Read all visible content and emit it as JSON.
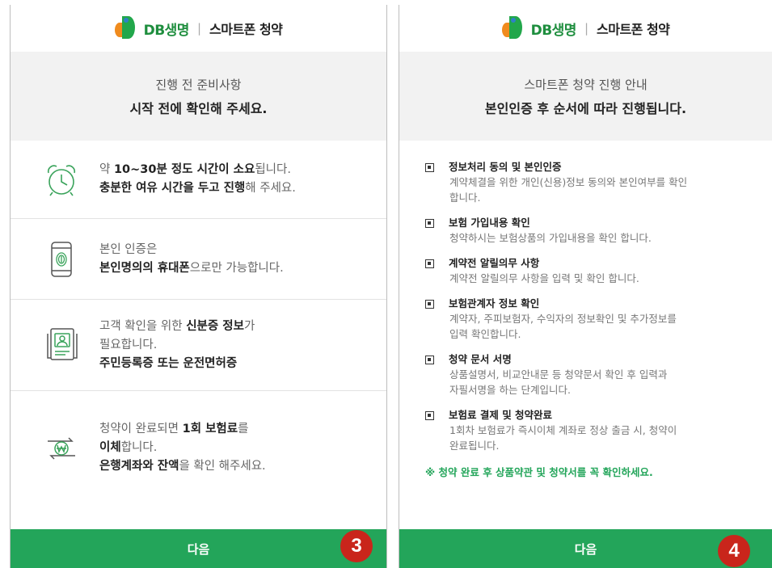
{
  "header": {
    "brand": "DB생명",
    "divider": "|",
    "subtitle": "스마트폰 청약"
  },
  "screen1": {
    "intro_line1": "진행 전 준비사항",
    "intro_line2": "시작 전에 확인해 주세요.",
    "items": [
      {
        "icon": "alarm-clock-icon",
        "segments": [
          {
            "t": "약 ",
            "b": false
          },
          {
            "t": "10~30분 정도 시간이 소요",
            "b": true
          },
          {
            "t": "됩니다.",
            "b": false
          },
          {
            "br": true
          },
          {
            "t": "충분한 여유 시간을 두고 진행",
            "b": true
          },
          {
            "t": "해 주세요.",
            "b": false
          }
        ]
      },
      {
        "icon": "phone-fingerprint-icon",
        "segments": [
          {
            "t": "본인 인증은",
            "b": false
          },
          {
            "br": true
          },
          {
            "t": "본인명의의 휴대폰",
            "b": true
          },
          {
            "t": "으로만 가능합니다.",
            "b": false
          }
        ]
      },
      {
        "icon": "id-card-icon",
        "segments": [
          {
            "t": "고객 확인을 위한 ",
            "b": false
          },
          {
            "t": "신분증 정보",
            "b": true
          },
          {
            "t": "가",
            "b": false
          },
          {
            "br": true
          },
          {
            "t": "필요합니다.",
            "b": false
          },
          {
            "br": true
          },
          {
            "t": "주민등록증 또는 운전면허증",
            "b": true
          }
        ]
      },
      {
        "icon": "won-transfer-icon",
        "segments": [
          {
            "t": "청약이 완료되면 ",
            "b": false
          },
          {
            "t": "1회 보험료",
            "b": true
          },
          {
            "t": "를",
            "b": false
          },
          {
            "br": true
          },
          {
            "t": "이체",
            "b": true
          },
          {
            "t": "합니다.",
            "b": false
          },
          {
            "br": true
          },
          {
            "t": "은행계좌와 잔액",
            "b": true
          },
          {
            "t": "을 확인 해주세요.",
            "b": false
          }
        ]
      }
    ],
    "next_label": "다음",
    "step_badge": "3"
  },
  "screen2": {
    "intro_line1": "스마트폰 청약 진행 안내",
    "intro_line2": "본인인증 후 순서에 따라 진행됩니다.",
    "steps": [
      {
        "title": "정보처리 동의 및 본인인증",
        "lines": [
          "계약체결을 위한 개인(신용)정보 동의와 본인여부를 확인",
          "합니다."
        ]
      },
      {
        "title": "보험 가입내용 확인",
        "lines": [
          "청약하시는 보험상품의 가입내용을 확인 합니다."
        ]
      },
      {
        "title": "계약전 알릴의무 사항",
        "lines": [
          "계약전 알릴의무 사항을 입력 및 확인 합니다."
        ]
      },
      {
        "title": "보험관계자 정보 확인",
        "lines": [
          "계약자, 주피보험자, 수익자의 정보확인 및 추가정보를",
          "입력 확인합니다."
        ]
      },
      {
        "title": "청약 문서 서명",
        "lines": [
          "상품설명서, 비교안내문 등 청약문서 확인 후 입력과",
          "자필서명을 하는 단계입니다."
        ]
      },
      {
        "title": "보험료 결제 및 청약완료",
        "lines": [
          "1회차 보험료가 즉시이체 계좌로 정상 출금 시, 청약이",
          "완료됩니다."
        ]
      }
    ],
    "note": "※ 청약 완료 후 상품약관 및 청약서를 꼭 확인하세요.",
    "next_label": "다음",
    "step_badge": "4"
  },
  "colors": {
    "accent": "#23a55a",
    "badge": "#c9251b",
    "brand": "#1e8e3e",
    "intro_bg": "#f2f2f2"
  }
}
